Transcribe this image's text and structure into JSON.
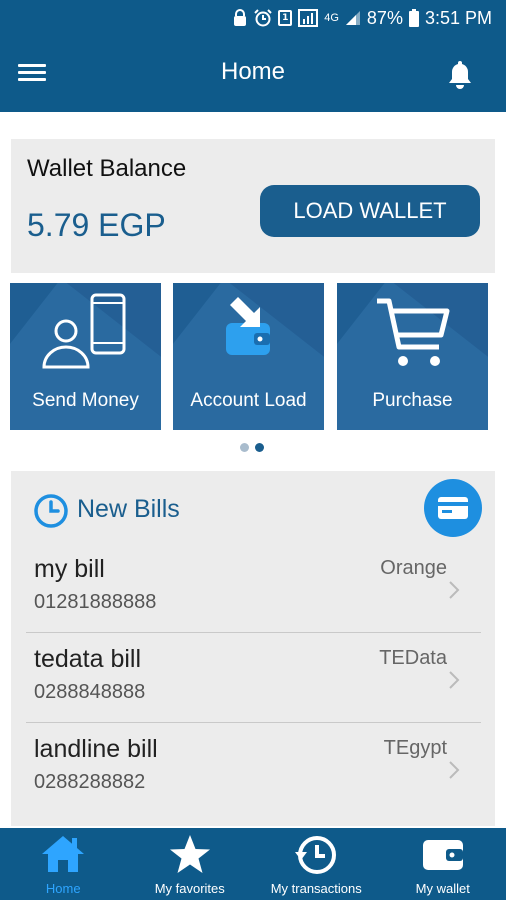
{
  "status_bar": {
    "network": "4G",
    "battery": "87%",
    "time": "3:51 PM",
    "sim_label": "1"
  },
  "app_bar": {
    "title": "Home",
    "menu_icon": "hamburger-menu-icon",
    "notification_icon": "bell-icon"
  },
  "wallet": {
    "label": "Wallet Balance",
    "amount": "5.79 EGP",
    "load_button": "LOAD WALLET"
  },
  "tiles": [
    {
      "label": "Send Money",
      "icon": "send-money-icon"
    },
    {
      "label": "Account Load",
      "icon": "account-load-icon"
    },
    {
      "label": "Purchase",
      "icon": "shopping-cart-icon"
    }
  ],
  "pager": {
    "pages": 2,
    "active_index": 1
  },
  "bills": {
    "title": "New Bills",
    "items": [
      {
        "name": "my bill",
        "number": "01281888888",
        "provider": "Orange"
      },
      {
        "name": "tedata bill",
        "number": "0288848888",
        "provider": "TEData"
      },
      {
        "name": "landline bill",
        "number": "0288288882",
        "provider": "TEgypt"
      }
    ]
  },
  "bottom_nav": [
    {
      "label": "Home",
      "icon": "home-icon",
      "active": true
    },
    {
      "label": "My favorites",
      "icon": "star-icon",
      "active": false
    },
    {
      "label": "My transactions",
      "icon": "history-icon",
      "active": false
    },
    {
      "label": "My wallet",
      "icon": "wallet-icon",
      "active": false
    }
  ],
  "colors": {
    "primary": "#0e5a8a",
    "accent": "#1e8fe0",
    "active_nav": "#2ea5ff",
    "card_bg": "#ececec"
  }
}
